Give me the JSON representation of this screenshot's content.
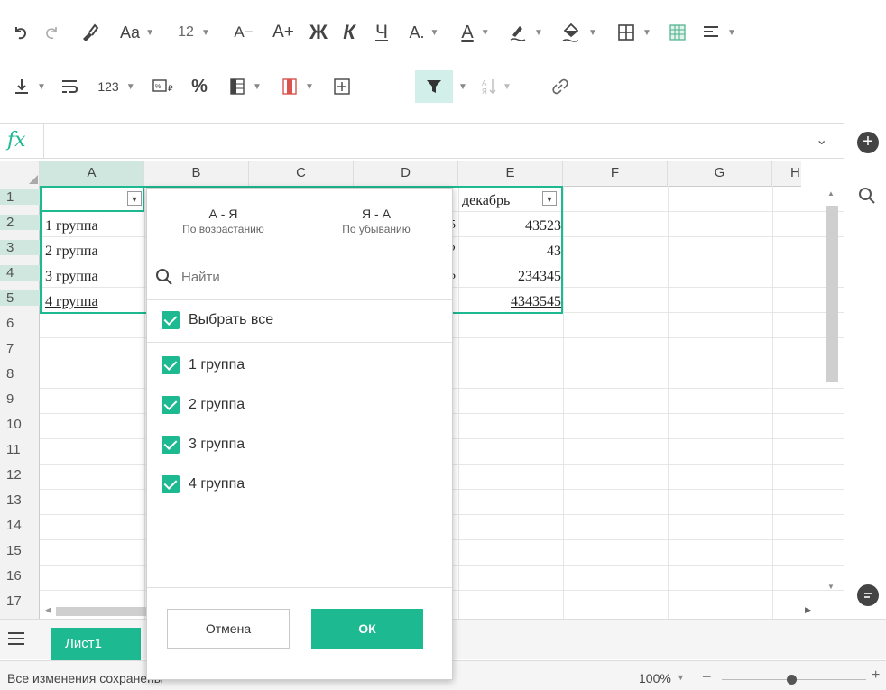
{
  "toolbar1": {
    "font_size": "12",
    "font_name_icon": "Aa",
    "dec_font": "A−",
    "inc_font": "A+",
    "bold": "Ж",
    "italic": "К",
    "underline": "Ч",
    "strike": "A."
  },
  "toolbar2": {
    "number_format": "123",
    "percent": "%"
  },
  "formula_bar": {
    "fx": "fx",
    "value": ""
  },
  "columns": [
    "A",
    "B",
    "C",
    "D",
    "E",
    "F",
    "G",
    "H"
  ],
  "rows": [
    "1",
    "2",
    "3",
    "4",
    "5",
    "6",
    "7",
    "8",
    "9",
    "10",
    "11",
    "12",
    "13",
    "14",
    "15",
    "16",
    "17"
  ],
  "cells": {
    "e1": "декабрь",
    "a2": "1 группа",
    "a3": "2 группа",
    "a4": "3 группа",
    "a5": "4 группа",
    "e2": "43523",
    "e3": "43",
    "e4": "234345",
    "e5": "4343545",
    "d2": "5",
    "d3": "2",
    "d4": "5"
  },
  "filter": {
    "sort_asc_title": "А - Я",
    "sort_asc_sub": "По возрастанию",
    "sort_desc_title": "Я - А",
    "sort_desc_sub": "По убыванию",
    "search_placeholder": "Найти",
    "select_all": "Выбрать все",
    "items": [
      "1 группа",
      "2 группа",
      "3 группа",
      "4 группа"
    ],
    "cancel": "Отмена",
    "ok": "ОК"
  },
  "sheet_tab": "Лист1",
  "status": {
    "saved": "Все изменения сохранены",
    "zoom": "100%"
  },
  "colors": {
    "accent": "#1db991",
    "filter_active_bg": "#d3efe9"
  }
}
